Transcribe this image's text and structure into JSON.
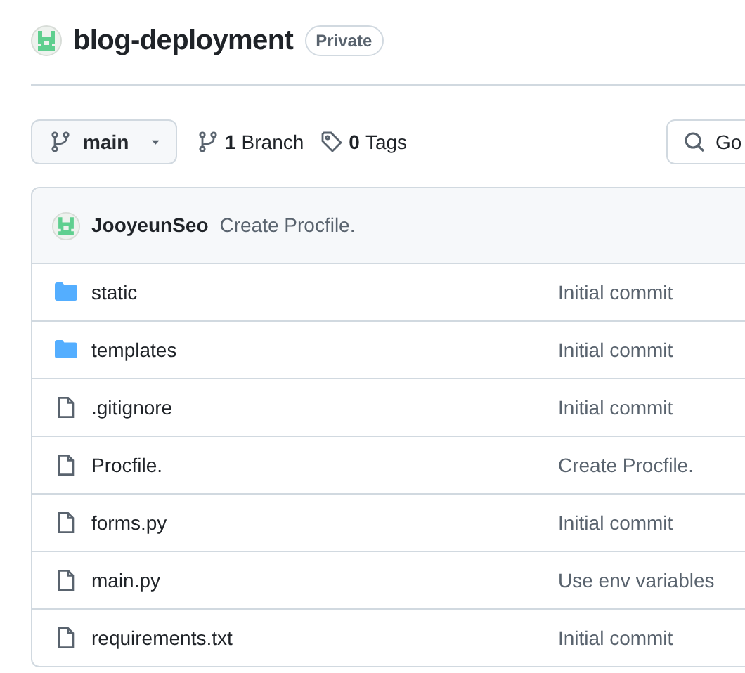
{
  "repo": {
    "name": "blog-deployment",
    "visibility": "Private"
  },
  "toolbar": {
    "branch": "main",
    "branches_count": "1",
    "branches_label": "Branch",
    "tags_count": "0",
    "tags_label": "Tags",
    "search": {
      "placeholder": "Go"
    }
  },
  "latest_commit": {
    "author": "JooyeunSeo",
    "message": "Create Procfile."
  },
  "files": [
    {
      "kind": "folder",
      "name": "static",
      "commit": "Initial commit"
    },
    {
      "kind": "folder",
      "name": "templates",
      "commit": "Initial commit"
    },
    {
      "kind": "file",
      "name": ".gitignore",
      "commit": "Initial commit"
    },
    {
      "kind": "file",
      "name": "Procfile.",
      "commit": "Create Procfile."
    },
    {
      "kind": "file",
      "name": "forms.py",
      "commit": "Initial commit"
    },
    {
      "kind": "file",
      "name": "main.py",
      "commit": "Use env variables"
    },
    {
      "kind": "file",
      "name": "requirements.txt",
      "commit": "Initial commit"
    }
  ]
}
